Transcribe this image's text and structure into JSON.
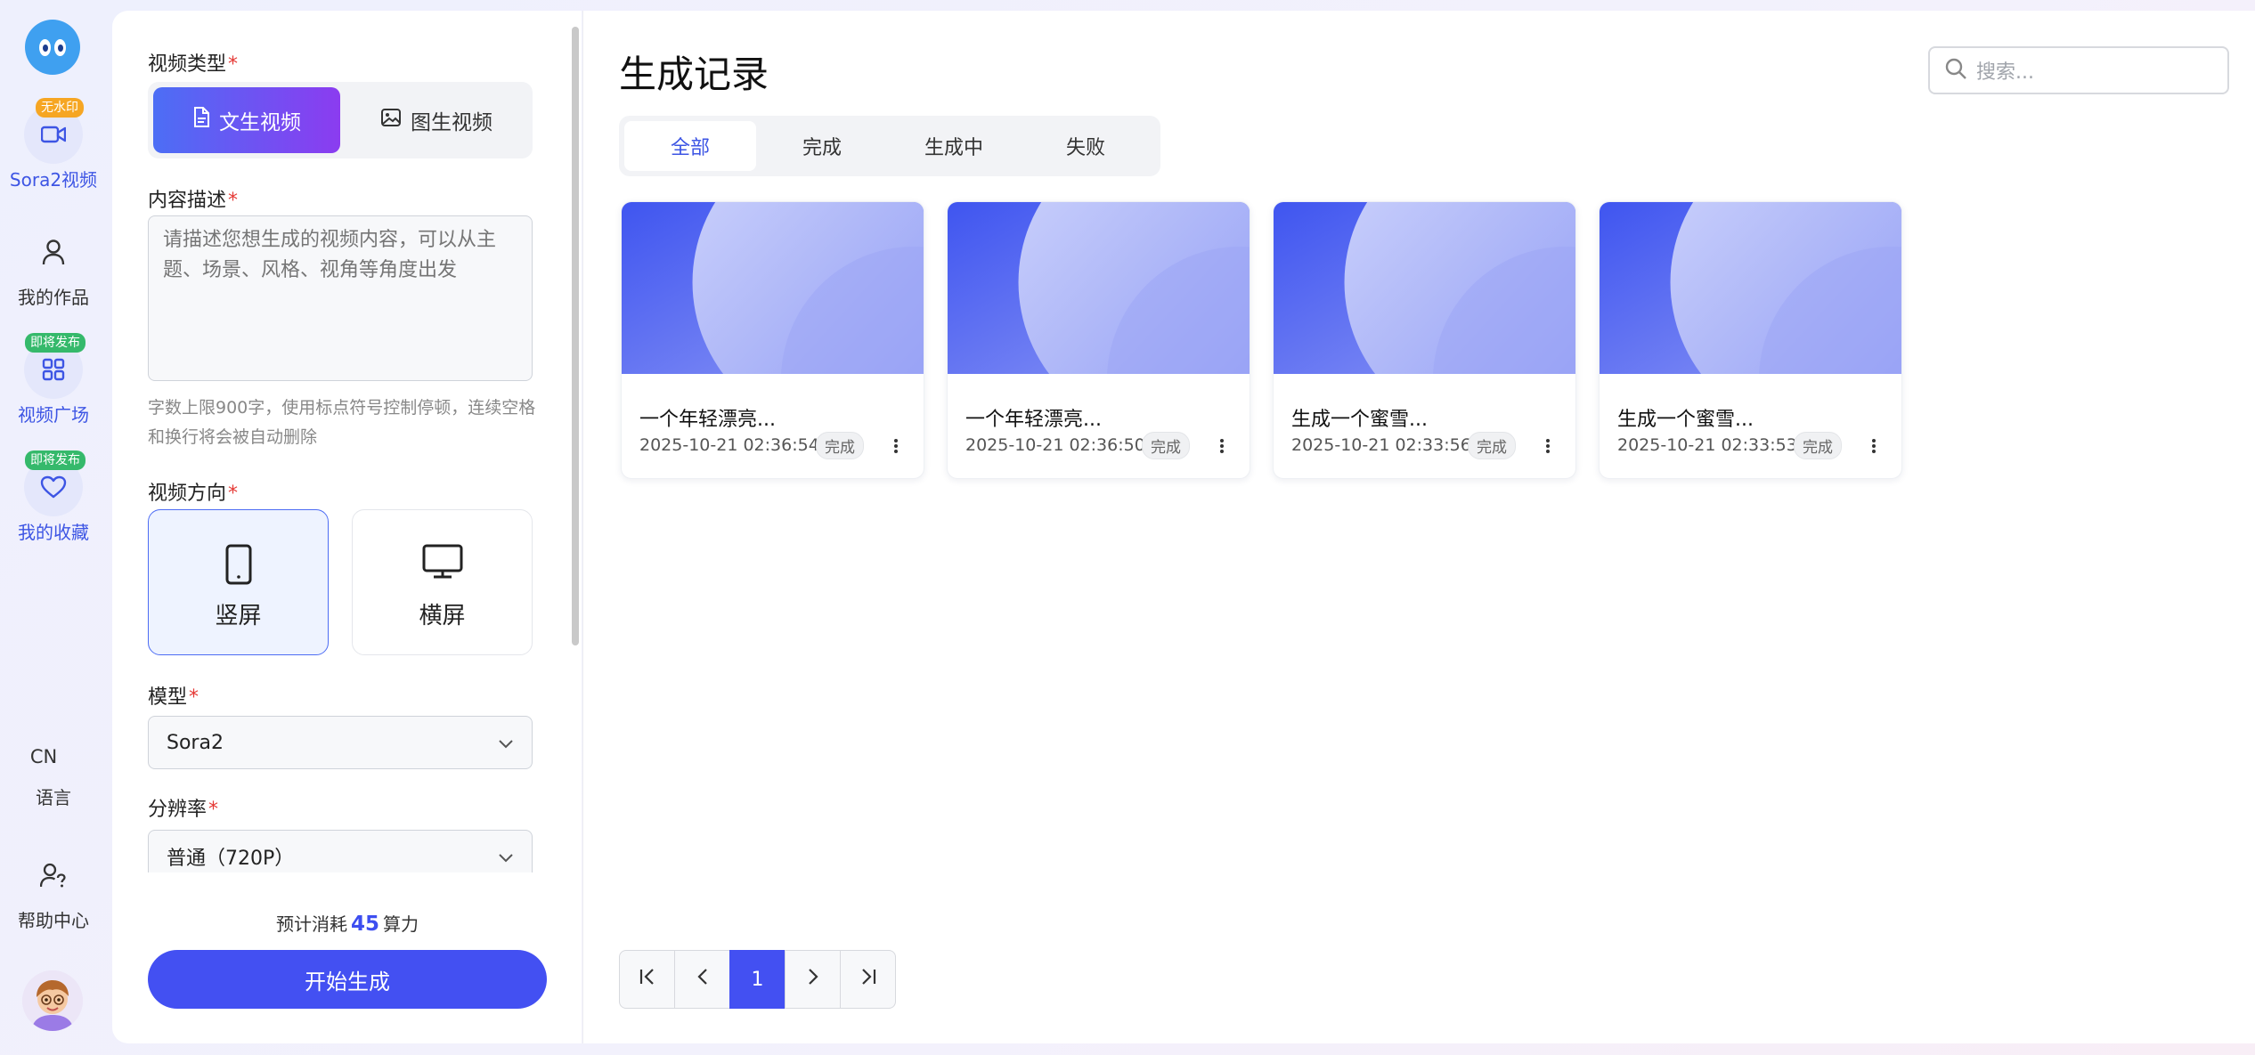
{
  "sidebar": {
    "items": [
      {
        "label": "Sora2视频",
        "tag": "无水印"
      },
      {
        "label": "我的作品"
      },
      {
        "label": "视频广场",
        "tag": "即将发布"
      },
      {
        "label": "我的收藏",
        "tag": "即将发布"
      }
    ],
    "lang_code": "CN",
    "lang_label": "语言",
    "help_label": "帮助中心"
  },
  "form": {
    "video_type_label": "视频类型",
    "required_mark": "*",
    "types": [
      "文生视频",
      "图生视频"
    ],
    "selected_type": "文生视频",
    "content_label": "内容描述",
    "content_placeholder": "请描述您想生成的视频内容，可以从主题、场景、风格、视角等角度出发",
    "content_hint": "字数上限900字，使用标点符号控制停顿，连续空格和换行将会被自动删除",
    "orientation_label": "视频方向",
    "orientations": [
      "竖屏",
      "横屏"
    ],
    "selected_orientation": "竖屏",
    "model_label": "模型",
    "model_value": "Sora2",
    "resolution_label": "分辨率",
    "resolution_value": "普通（720P）",
    "cost_prefix": "预计消耗",
    "cost_value": "45",
    "cost_suffix": "算力",
    "generate_label": "开始生成"
  },
  "main": {
    "title": "生成记录",
    "search_placeholder": "搜索...",
    "tabs": [
      "全部",
      "完成",
      "生成中",
      "失败"
    ],
    "active_tab": "全部",
    "records": [
      {
        "title": "一个年轻漂亮...",
        "date": "2025-10-21 02:36:54",
        "status": "完成"
      },
      {
        "title": "一个年轻漂亮...",
        "date": "2025-10-21 02:36:50",
        "status": "完成"
      },
      {
        "title": "生成一个蜜雪...",
        "date": "2025-10-21 02:33:56",
        "status": "完成"
      },
      {
        "title": "生成一个蜜雪...",
        "date": "2025-10-21 02:33:53",
        "status": "完成"
      }
    ],
    "pagination": {
      "current_page": "1"
    }
  },
  "colors": {
    "accent": "#4350f2",
    "gradient_start": "#4c6ef5",
    "gradient_end": "#8b3cf0",
    "badge_orange": "#f6a623",
    "badge_green": "#35b96b",
    "required": "#e53935"
  },
  "icons": {
    "logo": "bubble-eyes-logo",
    "sora_video": "video-camera-icon",
    "my_works": "user-icon",
    "plaza": "grid-icon",
    "favorites": "heart-icon",
    "help": "user-question-icon",
    "text_video": "document-icon",
    "image_video": "image-icon",
    "portrait": "phone-icon",
    "landscape": "monitor-icon",
    "dropdown": "chevron-down-icon",
    "search": "search-icon",
    "more": "more-vertical-icon",
    "pager": [
      "first-page-icon",
      "prev-page-icon",
      "next-page-icon",
      "last-page-icon"
    ]
  }
}
